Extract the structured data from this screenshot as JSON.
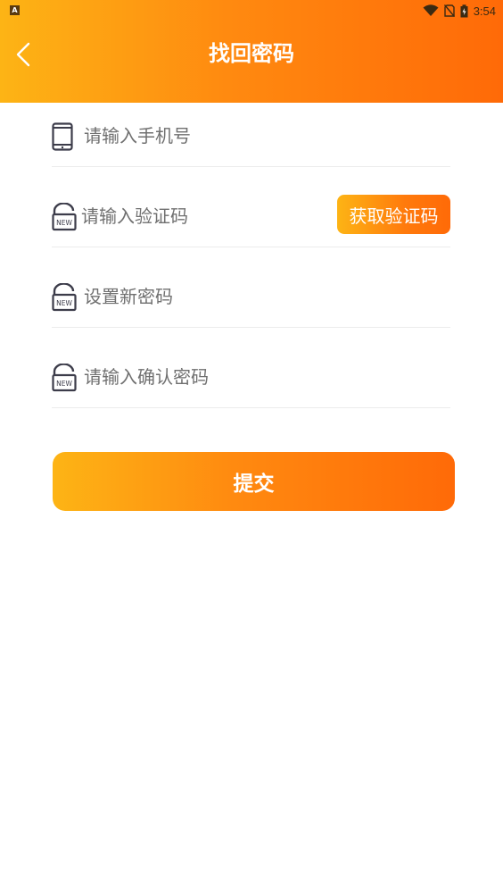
{
  "status_bar": {
    "time": "3:54",
    "notification_icon": "a-notification-icon",
    "wifi_icon": "wifi-icon",
    "sim_icon": "no-sim-icon",
    "battery_icon": "battery-charging-icon"
  },
  "header": {
    "title": "找回密码",
    "back_icon": "chevron-left-icon",
    "gradient_start": "#FDB415",
    "gradient_end": "#FF6A08"
  },
  "form": {
    "phone": {
      "placeholder": "请输入手机号",
      "value": "",
      "icon": "phone-icon"
    },
    "code": {
      "placeholder": "请输入验证码",
      "value": "",
      "icon": "lock-new-icon",
      "button_label": "获取验证码"
    },
    "new_password": {
      "placeholder": "设置新密码",
      "value": "",
      "icon": "lock-new-icon"
    },
    "confirm_password": {
      "placeholder": "请输入确认密码",
      "value": "",
      "icon": "lock-new-icon"
    },
    "lock_badge_text": "NEW"
  },
  "submit": {
    "label": "提交"
  }
}
